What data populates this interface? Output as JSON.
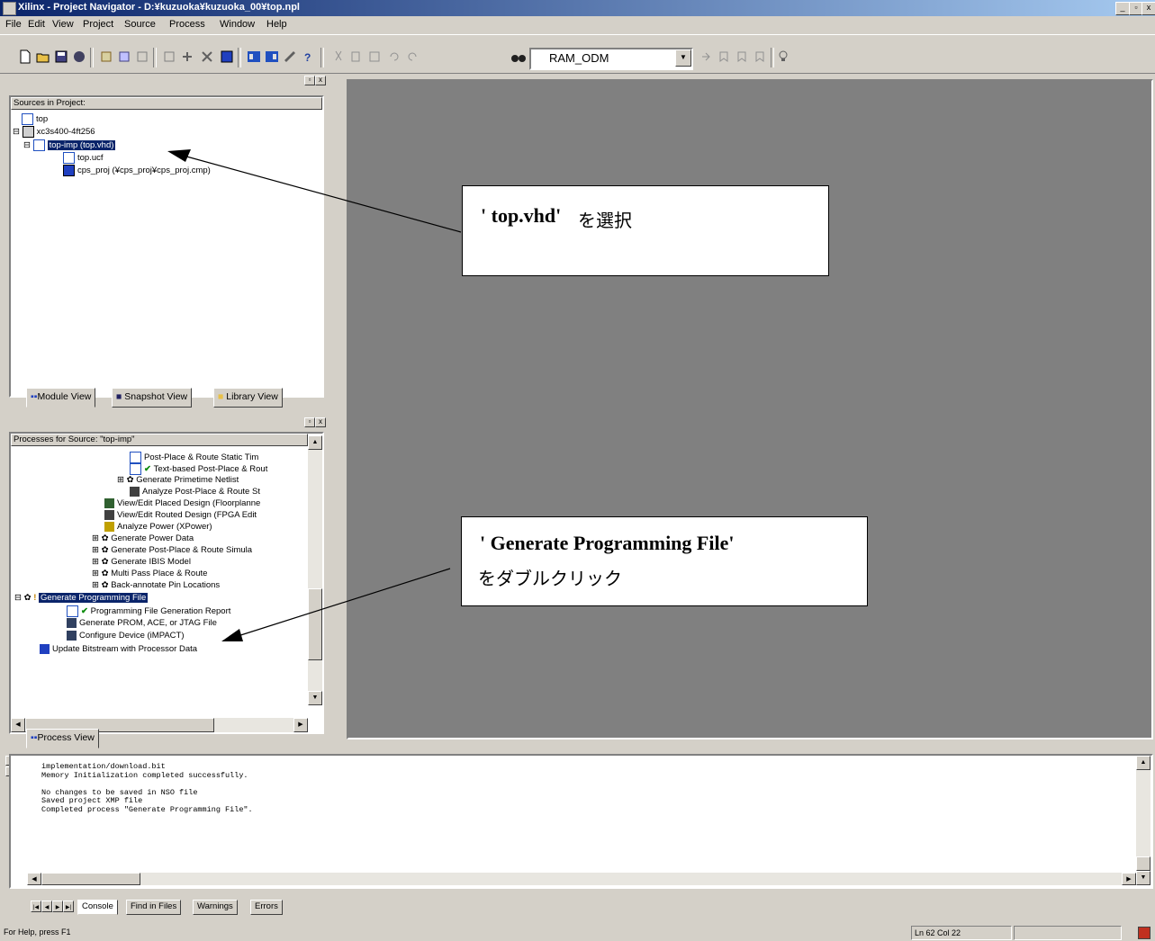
{
  "window": {
    "title": "Xilinx - Project Navigator - D:¥kuzuoka¥kuzuoka_00¥top.npl",
    "btn_min": "_",
    "btn_max": "▫",
    "btn_close": "x"
  },
  "menu": [
    "File",
    "Edit",
    "View",
    "Project",
    "Source",
    "Process",
    "Window",
    "Help"
  ],
  "toolbar": {
    "combo_value": "RAM_ODM"
  },
  "sources_panel": {
    "header": "Sources in Project:",
    "items": [
      "top",
      "xc3s400-4ft256",
      "top-imp (top.vhd)",
      "top.ucf",
      "cps_proj (¥cps_proj¥cps_proj.cmp)"
    ],
    "tabs": [
      "Module View",
      "Snapshot View",
      "Library View"
    ]
  },
  "processes_panel": {
    "header": "Processes for Source: \"top-imp\"",
    "items": [
      "Post-Place & Route Static Tim",
      "Text-based Post-Place & Rout",
      "Generate Primetime Netlist",
      "Analyze Post-Place & Route St",
      "View/Edit Placed Design (Floorplanne",
      "View/Edit Routed Design (FPGA Edit",
      "Analyze Power (XPower)",
      "Generate Power Data",
      "Generate Post-Place & Route Simula",
      "Generate IBIS Model",
      "Multi Pass Place & Route",
      "Back-annotate Pin Locations",
      "Generate Programming File",
      "Programming File Generation Report",
      "Generate PROM, ACE, or JTAG File",
      "Configure Device (iMPACT)",
      "Update Bitstream with Processor Data"
    ],
    "tab": "Process View"
  },
  "callouts": {
    "c1_a": "' top.vhd'",
    "c1_b": "を選択",
    "c2_a": "' Generate Programming File'",
    "c2_b": "をダブルクリック"
  },
  "console": {
    "text": "implementation/download.bit\nMemory Initialization completed successfully.\n\nNo changes to be saved in NSO file\nSaved project XMP file\nCompleted process \"Generate Programming File\".",
    "tabs": [
      "Console",
      "Find in Files",
      "Warnings",
      "Errors"
    ]
  },
  "status": {
    "help": "For Help, press F1",
    "position": "Ln 62 Col 22"
  }
}
